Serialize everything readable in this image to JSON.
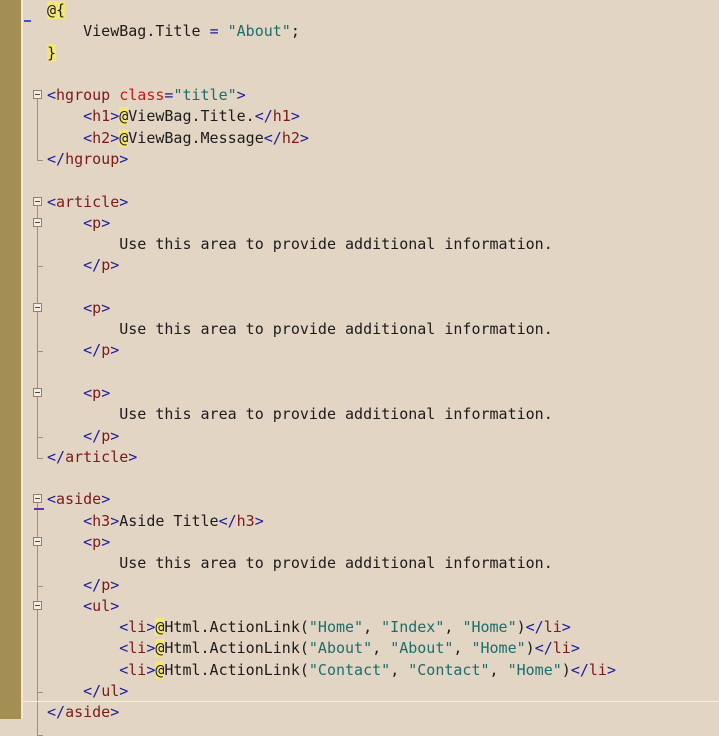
{
  "editor": {
    "lines": [
      {
        "parts": [
          {
            "t": "razor",
            "v": "@{"
          }
        ]
      },
      {
        "parts": [
          {
            "t": "kw",
            "v": "    ViewBag.Title "
          },
          {
            "t": "punct",
            "v": "= "
          },
          {
            "t": "str",
            "v": "\"About\""
          },
          {
            "t": "kw",
            "v": ";"
          }
        ]
      },
      {
        "parts": [
          {
            "t": "razor",
            "v": "}"
          }
        ]
      },
      {
        "parts": []
      },
      {
        "parts": [
          {
            "t": "punct",
            "v": "<"
          },
          {
            "t": "el",
            "v": "hgroup"
          },
          {
            "t": "kw",
            "v": " "
          },
          {
            "t": "attr",
            "v": "class"
          },
          {
            "t": "punct",
            "v": "="
          },
          {
            "t": "str",
            "v": "\"title\""
          },
          {
            "t": "punct",
            "v": ">"
          }
        ]
      },
      {
        "parts": [
          {
            "t": "kw",
            "v": "    "
          },
          {
            "t": "punct",
            "v": "<"
          },
          {
            "t": "el",
            "v": "h1"
          },
          {
            "t": "punct",
            "v": ">"
          },
          {
            "t": "razor",
            "v": "@"
          },
          {
            "t": "kw",
            "v": "ViewBag.Title."
          },
          {
            "t": "punct",
            "v": "</"
          },
          {
            "t": "el",
            "v": "h1"
          },
          {
            "t": "punct",
            "v": ">"
          }
        ]
      },
      {
        "parts": [
          {
            "t": "kw",
            "v": "    "
          },
          {
            "t": "punct",
            "v": "<"
          },
          {
            "t": "el",
            "v": "h2"
          },
          {
            "t": "punct",
            "v": ">"
          },
          {
            "t": "razor",
            "v": "@"
          },
          {
            "t": "kw",
            "v": "ViewBag.Message"
          },
          {
            "t": "punct",
            "v": "</"
          },
          {
            "t": "el",
            "v": "h2"
          },
          {
            "t": "punct",
            "v": ">"
          }
        ]
      },
      {
        "parts": [
          {
            "t": "punct",
            "v": "</"
          },
          {
            "t": "el",
            "v": "hgroup"
          },
          {
            "t": "punct",
            "v": ">"
          }
        ]
      },
      {
        "parts": []
      },
      {
        "parts": [
          {
            "t": "punct",
            "v": "<"
          },
          {
            "t": "el",
            "v": "article"
          },
          {
            "t": "punct",
            "v": ">"
          }
        ]
      },
      {
        "parts": [
          {
            "t": "kw",
            "v": "    "
          },
          {
            "t": "punct",
            "v": "<"
          },
          {
            "t": "el",
            "v": "p"
          },
          {
            "t": "punct",
            "v": ">"
          }
        ]
      },
      {
        "parts": [
          {
            "t": "kw",
            "v": "        Use this area to provide additional information."
          }
        ]
      },
      {
        "parts": [
          {
            "t": "kw",
            "v": "    "
          },
          {
            "t": "punct",
            "v": "</"
          },
          {
            "t": "el",
            "v": "p"
          },
          {
            "t": "punct",
            "v": ">"
          }
        ]
      },
      {
        "parts": []
      },
      {
        "parts": [
          {
            "t": "kw",
            "v": "    "
          },
          {
            "t": "punct",
            "v": "<"
          },
          {
            "t": "el",
            "v": "p"
          },
          {
            "t": "punct",
            "v": ">"
          }
        ]
      },
      {
        "parts": [
          {
            "t": "kw",
            "v": "        Use this area to provide additional information."
          }
        ]
      },
      {
        "parts": [
          {
            "t": "kw",
            "v": "    "
          },
          {
            "t": "punct",
            "v": "</"
          },
          {
            "t": "el",
            "v": "p"
          },
          {
            "t": "punct",
            "v": ">"
          }
        ]
      },
      {
        "parts": []
      },
      {
        "parts": [
          {
            "t": "kw",
            "v": "    "
          },
          {
            "t": "punct",
            "v": "<"
          },
          {
            "t": "el",
            "v": "p"
          },
          {
            "t": "punct",
            "v": ">"
          }
        ]
      },
      {
        "parts": [
          {
            "t": "kw",
            "v": "        Use this area to provide additional information."
          }
        ]
      },
      {
        "parts": [
          {
            "t": "kw",
            "v": "    "
          },
          {
            "t": "punct",
            "v": "</"
          },
          {
            "t": "el",
            "v": "p"
          },
          {
            "t": "punct",
            "v": ">"
          }
        ]
      },
      {
        "parts": [
          {
            "t": "punct",
            "v": "</"
          },
          {
            "t": "el",
            "v": "article"
          },
          {
            "t": "punct",
            "v": ">"
          }
        ]
      },
      {
        "parts": []
      },
      {
        "parts": [
          {
            "t": "punct",
            "v": "<"
          },
          {
            "t": "el",
            "v": "aside"
          },
          {
            "t": "punct",
            "v": ">"
          }
        ]
      },
      {
        "parts": [
          {
            "t": "kw",
            "v": "    "
          },
          {
            "t": "punct",
            "v": "<"
          },
          {
            "t": "el",
            "v": "h3"
          },
          {
            "t": "punct",
            "v": ">"
          },
          {
            "t": "kw",
            "v": "Aside Title"
          },
          {
            "t": "punct",
            "v": "</"
          },
          {
            "t": "el",
            "v": "h3"
          },
          {
            "t": "punct",
            "v": ">"
          }
        ]
      },
      {
        "parts": [
          {
            "t": "kw",
            "v": "    "
          },
          {
            "t": "punct",
            "v": "<"
          },
          {
            "t": "el",
            "v": "p"
          },
          {
            "t": "punct",
            "v": ">"
          }
        ]
      },
      {
        "parts": [
          {
            "t": "kw",
            "v": "        Use this area to provide additional information."
          }
        ]
      },
      {
        "parts": [
          {
            "t": "kw",
            "v": "    "
          },
          {
            "t": "punct",
            "v": "</"
          },
          {
            "t": "el",
            "v": "p"
          },
          {
            "t": "punct",
            "v": ">"
          }
        ]
      },
      {
        "parts": [
          {
            "t": "kw",
            "v": "    "
          },
          {
            "t": "punct",
            "v": "<"
          },
          {
            "t": "el",
            "v": "ul"
          },
          {
            "t": "punct",
            "v": ">"
          }
        ]
      },
      {
        "parts": [
          {
            "t": "kw",
            "v": "        "
          },
          {
            "t": "punct",
            "v": "<"
          },
          {
            "t": "el",
            "v": "li"
          },
          {
            "t": "punct",
            "v": ">"
          },
          {
            "t": "razor",
            "v": "@"
          },
          {
            "t": "kw",
            "v": "Html.ActionLink("
          },
          {
            "t": "str",
            "v": "\"Home\""
          },
          {
            "t": "kw",
            "v": ", "
          },
          {
            "t": "str",
            "v": "\"Index\""
          },
          {
            "t": "kw",
            "v": ", "
          },
          {
            "t": "str",
            "v": "\"Home\""
          },
          {
            "t": "kw",
            "v": ")"
          },
          {
            "t": "punct",
            "v": "</"
          },
          {
            "t": "el",
            "v": "li"
          },
          {
            "t": "punct",
            "v": ">"
          }
        ]
      },
      {
        "parts": [
          {
            "t": "kw",
            "v": "        "
          },
          {
            "t": "punct",
            "v": "<"
          },
          {
            "t": "el",
            "v": "li"
          },
          {
            "t": "punct",
            "v": ">"
          },
          {
            "t": "razor",
            "v": "@"
          },
          {
            "t": "kw",
            "v": "Html.ActionLink("
          },
          {
            "t": "str",
            "v": "\"About\""
          },
          {
            "t": "kw",
            "v": ", "
          },
          {
            "t": "str",
            "v": "\"About\""
          },
          {
            "t": "kw",
            "v": ", "
          },
          {
            "t": "str",
            "v": "\"Home\""
          },
          {
            "t": "kw",
            "v": ")"
          },
          {
            "t": "punct",
            "v": "</"
          },
          {
            "t": "el",
            "v": "li"
          },
          {
            "t": "punct",
            "v": ">"
          }
        ]
      },
      {
        "parts": [
          {
            "t": "kw",
            "v": "        "
          },
          {
            "t": "punct",
            "v": "<"
          },
          {
            "t": "el",
            "v": "li"
          },
          {
            "t": "punct",
            "v": ">"
          },
          {
            "t": "razor",
            "v": "@"
          },
          {
            "t": "kw",
            "v": "Html.ActionLink("
          },
          {
            "t": "str",
            "v": "\"Contact\""
          },
          {
            "t": "kw",
            "v": ", "
          },
          {
            "t": "str",
            "v": "\"Contact\""
          },
          {
            "t": "kw",
            "v": ", "
          },
          {
            "t": "str",
            "v": "\"Home\""
          },
          {
            "t": "kw",
            "v": ")"
          },
          {
            "t": "punct",
            "v": "</"
          },
          {
            "t": "el",
            "v": "li"
          },
          {
            "t": "punct",
            "v": ">"
          }
        ]
      },
      {
        "parts": [
          {
            "t": "kw",
            "v": "    "
          },
          {
            "t": "punct",
            "v": "</"
          },
          {
            "t": "el",
            "v": "ul"
          },
          {
            "t": "punct",
            "v": ">"
          }
        ]
      },
      {
        "parts": [
          {
            "t": "punct",
            "v": "</"
          },
          {
            "t": "el",
            "v": "aside"
          },
          {
            "t": "punct",
            "v": ">"
          }
        ]
      }
    ],
    "fold_markers": [
      "collapse-icon",
      "collapse-icon",
      "collapse-icon",
      "collapse-icon",
      "collapse-icon",
      "collapse-icon",
      "collapse-icon",
      "collapse-icon"
    ]
  }
}
